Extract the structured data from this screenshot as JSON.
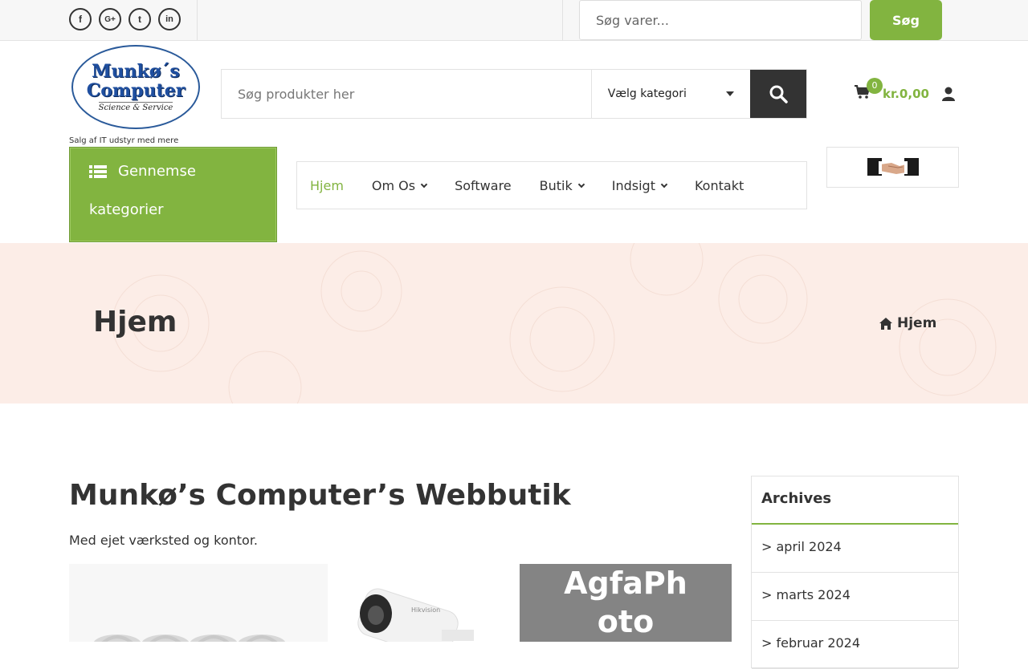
{
  "topbar": {
    "social": [
      {
        "icon": "facebook-icon",
        "glyph": "f"
      },
      {
        "icon": "google-plus-icon",
        "glyph": "G+"
      },
      {
        "icon": "twitter-icon",
        "glyph": "t"
      },
      {
        "icon": "linkedin-icon",
        "glyph": "in"
      }
    ],
    "search_placeholder": "Søg varer...",
    "search_button": "Søg"
  },
  "header": {
    "logo": {
      "line1": "Munkø´s",
      "line2": "Computer",
      "line3": "Science & Service"
    },
    "tagline": "Salg af IT udstyr med mere",
    "search_placeholder": "Søg produkter her",
    "category_select": "Vælg kategori",
    "cart_count": "0",
    "cart_total": "kr.0,00"
  },
  "categories_box": {
    "line1": "Gennemse",
    "line2": "kategorier"
  },
  "nav": {
    "items": [
      {
        "label": "Hjem",
        "active": true,
        "dropdown": false
      },
      {
        "label": "Om Os",
        "active": false,
        "dropdown": true
      },
      {
        "label": "Software",
        "active": false,
        "dropdown": false
      },
      {
        "label": "Butik",
        "active": false,
        "dropdown": true
      },
      {
        "label": "Indsigt",
        "active": false,
        "dropdown": true
      },
      {
        "label": "Kontakt",
        "active": false,
        "dropdown": false
      }
    ]
  },
  "hero": {
    "title": "Hjem",
    "breadcrumb": "Hjem"
  },
  "content": {
    "title": "Munkø’s Computer’s Webbutik",
    "lead": "Med ejet værksted og kontor.",
    "agfa_text": "AgfaPhoto"
  },
  "sidebar": {
    "archives_title": "Archives",
    "archives": [
      "> april 2024",
      "> marts 2024",
      "> februar 2024"
    ]
  },
  "colors": {
    "accent": "#82b440",
    "dark": "#333333",
    "hero_bg": "#fcede7"
  }
}
